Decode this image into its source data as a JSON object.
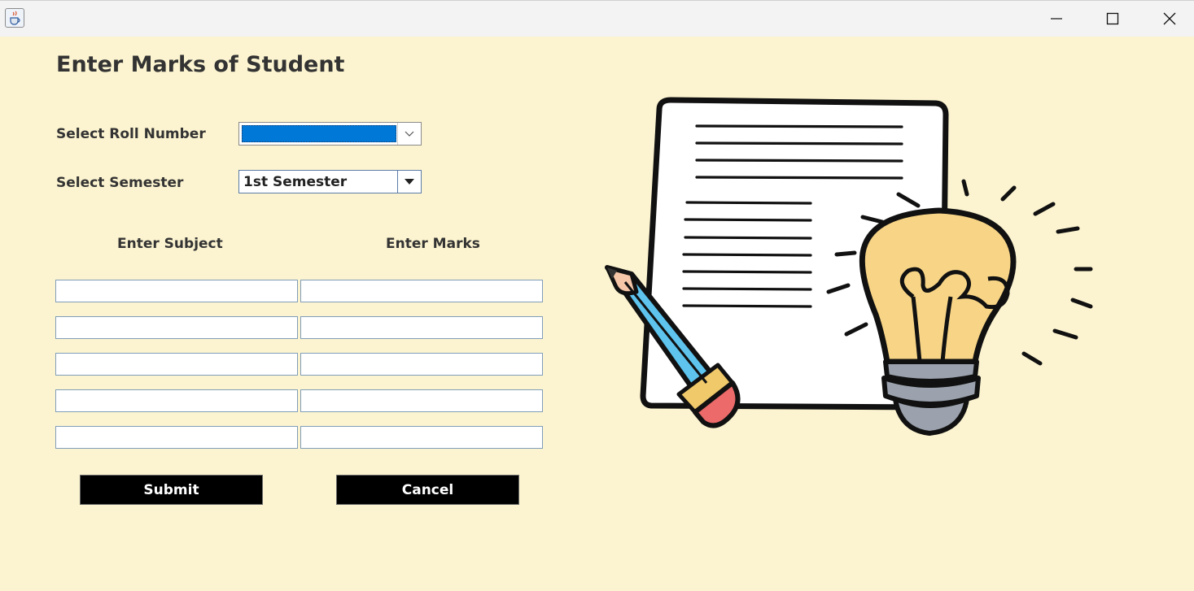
{
  "window": {
    "icons": {
      "app": "java-cup-icon",
      "minimize": "minimize-icon",
      "maximize": "maximize-icon",
      "close": "close-icon"
    }
  },
  "form": {
    "title": "Enter Marks of Student",
    "roll_label": "Select Roll Number",
    "roll_value": "",
    "semester_label": "Select Semester",
    "semester_value": "1st Semester",
    "col_subject": "Enter Subject",
    "col_marks": "Enter Marks",
    "rows": [
      {
        "subject": "",
        "marks": ""
      },
      {
        "subject": "",
        "marks": ""
      },
      {
        "subject": "",
        "marks": ""
      },
      {
        "subject": "",
        "marks": ""
      },
      {
        "subject": "",
        "marks": ""
      }
    ],
    "submit_label": "Submit",
    "cancel_label": "Cancel"
  },
  "colors": {
    "background": "#fcf4d0",
    "selection": "#0078d7",
    "button": "#000000",
    "button_text": "#ffffff"
  }
}
